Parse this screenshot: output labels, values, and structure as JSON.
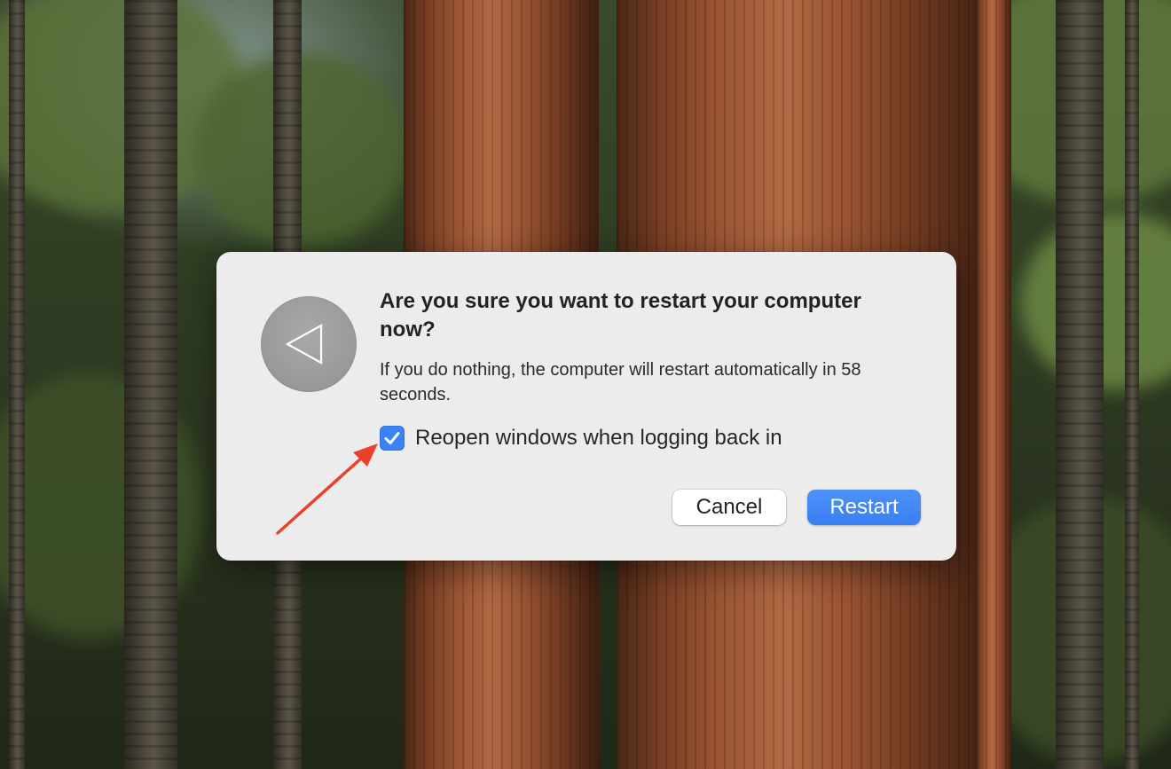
{
  "dialog": {
    "title": "Are you sure you want to restart your computer now?",
    "message": "If you do nothing, the computer will restart automatically in 58 seconds.",
    "checkbox": {
      "label": "Reopen windows when logging back in",
      "checked": true
    },
    "cancel_label": "Cancel",
    "restart_label": "Restart",
    "icon": "restart-triangle-icon"
  },
  "colors": {
    "dialog_background": "#ececec",
    "accent": "#3a82f6",
    "annotation_arrow": "#e8412c"
  }
}
